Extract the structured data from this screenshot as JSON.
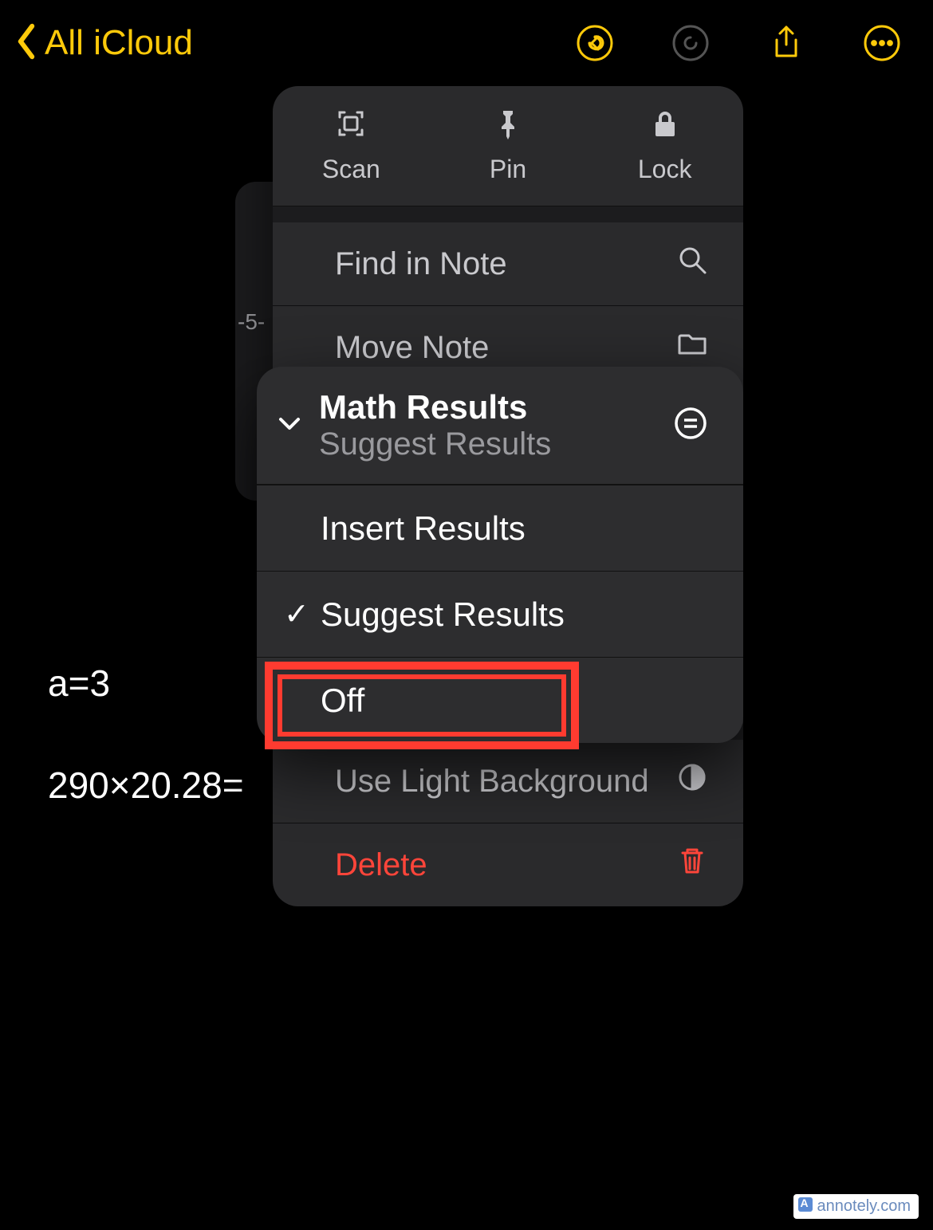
{
  "nav": {
    "back_label": "All iCloud"
  },
  "note": {
    "line1": "a=3",
    "line2": "290×20.28="
  },
  "bg_tick": "-5-",
  "menu": {
    "top": {
      "scan": "Scan",
      "pin": "Pin",
      "lock": "Lock"
    },
    "find": "Find in Note",
    "move": "Move Note",
    "math_title": "Math Results",
    "math_sub": "Suggest Results",
    "light": "Use Light Background",
    "delete": "Delete"
  },
  "submenu": {
    "title": "Math Results",
    "subtitle": "Suggest Results",
    "opt_insert": "Insert Results",
    "opt_suggest": "Suggest Results",
    "opt_off": "Off"
  },
  "watermark": "annotely.com"
}
